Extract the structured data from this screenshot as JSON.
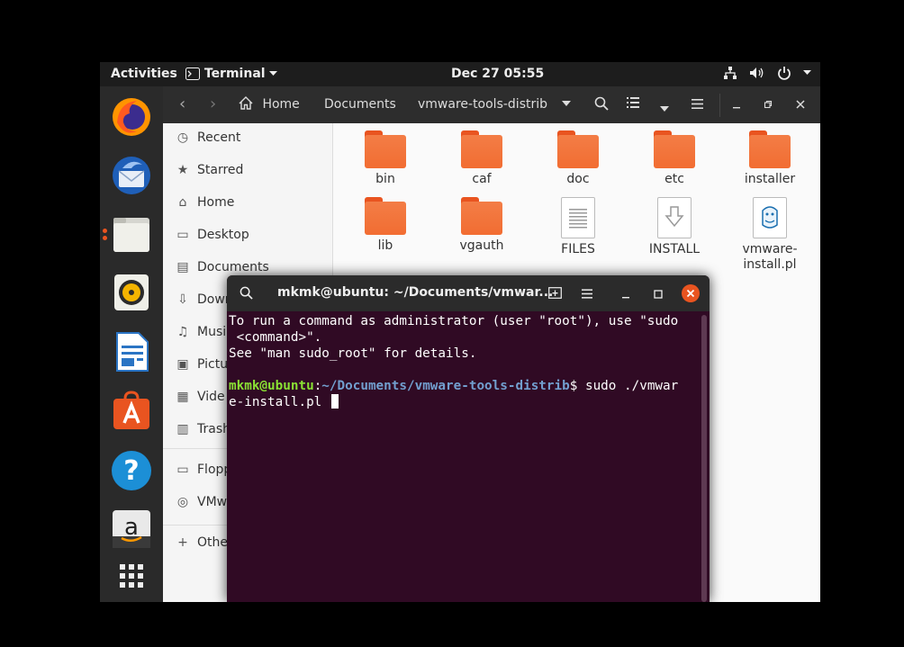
{
  "topbar": {
    "activities": "Activities",
    "app_name": "Terminal",
    "clock": "Dec 27  05:55"
  },
  "dock": {
    "items": [
      {
        "name": "Firefox",
        "icon": "firefox-icon",
        "running": false
      },
      {
        "name": "Thunderbird",
        "icon": "thunderbird-icon",
        "running": false
      },
      {
        "name": "Files",
        "icon": "files-icon",
        "running": true
      },
      {
        "name": "Rhythmbox",
        "icon": "rhythmbox-icon",
        "running": false
      },
      {
        "name": "LibreOffice Writer",
        "icon": "writer-icon",
        "running": false
      },
      {
        "name": "Ubuntu Software",
        "icon": "software-icon",
        "running": false
      },
      {
        "name": "Help",
        "icon": "help-icon",
        "running": false
      },
      {
        "name": "Amazon",
        "icon": "amazon-icon",
        "running": false
      },
      {
        "name": "Show Applications",
        "icon": "app-grid-icon",
        "running": false
      }
    ],
    "help_glyph": "?",
    "amazon_glyph": "a"
  },
  "files": {
    "path": [
      "Home",
      "Documents",
      "vmware-tools-distrib"
    ],
    "sidebar": [
      {
        "icon": "clock-icon",
        "glyph": "◷",
        "label": "Recent"
      },
      {
        "icon": "star-icon",
        "glyph": "★",
        "label": "Starred"
      },
      {
        "icon": "home-icon",
        "glyph": "⌂",
        "label": "Home"
      },
      {
        "icon": "desktop-icon",
        "glyph": "▭",
        "label": "Desktop"
      },
      {
        "icon": "documents-icon",
        "glyph": "▤",
        "label": "Documents"
      },
      {
        "icon": "downloads-icon",
        "glyph": "⇩",
        "label": "Down"
      },
      {
        "icon": "music-icon",
        "glyph": "♫",
        "label": "Musi"
      },
      {
        "icon": "pictures-icon",
        "glyph": "▣",
        "label": "Pictu"
      },
      {
        "icon": "videos-icon",
        "glyph": "▦",
        "label": "Vide"
      },
      {
        "icon": "trash-icon",
        "glyph": "▥",
        "label": "Trash"
      },
      {
        "icon": "floppy-icon",
        "glyph": "▭",
        "label": "Flopp"
      },
      {
        "icon": "disc-icon",
        "glyph": "◎",
        "label": "VMw"
      },
      {
        "icon": "plus-icon",
        "glyph": "+",
        "label": "Othe"
      }
    ],
    "items": [
      {
        "name": "bin",
        "kind": "folder"
      },
      {
        "name": "caf",
        "kind": "folder"
      },
      {
        "name": "doc",
        "kind": "folder"
      },
      {
        "name": "etc",
        "kind": "folder"
      },
      {
        "name": "installer",
        "kind": "folder"
      },
      {
        "name": "lib",
        "kind": "folder"
      },
      {
        "name": "vgauth",
        "kind": "folder"
      },
      {
        "name": "FILES",
        "kind": "text"
      },
      {
        "name": "INSTALL",
        "kind": "install"
      },
      {
        "name": "vmware-\ninstall.pl",
        "kind": "perl"
      }
    ]
  },
  "terminal": {
    "title": "mkmk@ubuntu: ~/Documents/vmwar...",
    "line1": "To run a command as administrator (user \"root\"), use \"sudo",
    "line2": " <command>\".",
    "line3": "See \"man sudo_root\" for details.",
    "prompt_user": "mkmk@ubuntu",
    "prompt_colon": ":",
    "prompt_path": "~/Documents/vmware-tools-distrib",
    "prompt_cmd": "$ sudo ./vmwar",
    "line_wrap": "e-install.pl "
  },
  "colors": {
    "ubuntu_orange": "#e95420",
    "terminal_bg": "#300a24",
    "prompt_green": "#8ae234",
    "prompt_blue": "#729fcf"
  }
}
